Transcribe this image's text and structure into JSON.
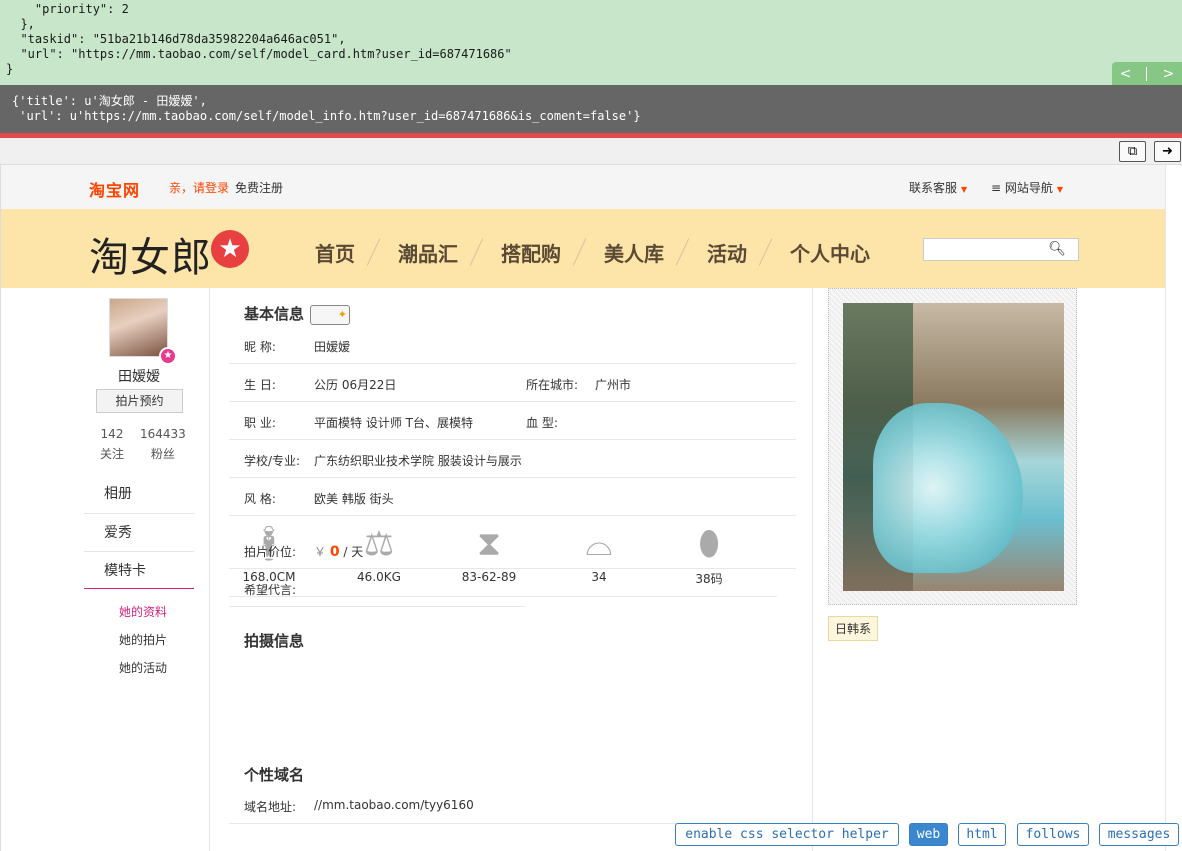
{
  "debug": {
    "json_lines": [
      "    \"priority\": 2",
      "  },",
      "  \"taskid\": \"51ba21b146d78da35982204a646ac051\",",
      "  \"url\": \"https://mm.taobao.com/self/model_card.htm?user_id=687471686\"",
      "}"
    ],
    "nav_prev": "<",
    "nav_next": ">",
    "result_lines": [
      "{'title': u'淘女郎 - 田嫒嫒',",
      " 'url': u'https://mm.taobao.com/self/model_info.htm?user_id=687471686&is_coment=false'}"
    ],
    "copy_icon": "copy-icon",
    "go_icon": "arrow-right-icon"
  },
  "topbar": {
    "logo": "淘宝网",
    "login": "亲，请登录",
    "register": "免费注册",
    "service": "联系客服",
    "site_nav": "≡ 网站导航"
  },
  "header": {
    "brand": "淘女郎",
    "nav": [
      "首页",
      "潮品汇",
      "搭配购",
      "美人库",
      "活动",
      "个人中心"
    ],
    "search_placeholder": ""
  },
  "profile": {
    "name": "田嫒嫒",
    "book_button": "拍片预约",
    "follows_count": "142",
    "follows_label": "关注",
    "fans_count": "164433",
    "fans_label": "粉丝",
    "menu": [
      "相册",
      "爱秀",
      "模特卡"
    ],
    "submenu": [
      "她的资料",
      "她的拍片",
      "她的活动"
    ]
  },
  "basic": {
    "title": "基本信息",
    "nickname_label": "昵  称:",
    "nickname": "田嫒嫒",
    "birthday_label": "生      日:",
    "birthday": "公历   06月22日",
    "city_label": "所在城市:",
    "city": "广州市",
    "job_label": "职      业:",
    "job": "平面模特 设计师 T台、展模特",
    "blood_label": "血      型:",
    "blood": "",
    "school_label": "学校/专业:",
    "school": "广东纺织职业技术学院     服装设计与展示",
    "style_label": "风      格:",
    "style": "欧美 韩版 街头",
    "figures": [
      {
        "icon": "height-icon",
        "value": "168.0CM"
      },
      {
        "icon": "weight-icon",
        "value": "46.0KG"
      },
      {
        "icon": "measurements-icon",
        "value": "83-62-89"
      },
      {
        "icon": "bra-icon",
        "value": "34"
      },
      {
        "icon": "shoes-icon",
        "value": "38码"
      }
    ]
  },
  "shoot": {
    "title": "拍摄信息",
    "price_label": "拍片价位:",
    "price_yen": "￥",
    "price_value": "0",
    "price_unit": "/ 天",
    "wish_label": "希望代言:",
    "wish": ""
  },
  "domain": {
    "title": "个性域名",
    "label": "域名地址:",
    "value": "//mm.taobao.com/tyy6160"
  },
  "right": {
    "tag": "日韩系"
  },
  "toolbar": {
    "css_helper": "enable css selector helper",
    "web": "web",
    "html": "html",
    "follows": "follows",
    "messages": "messages"
  }
}
